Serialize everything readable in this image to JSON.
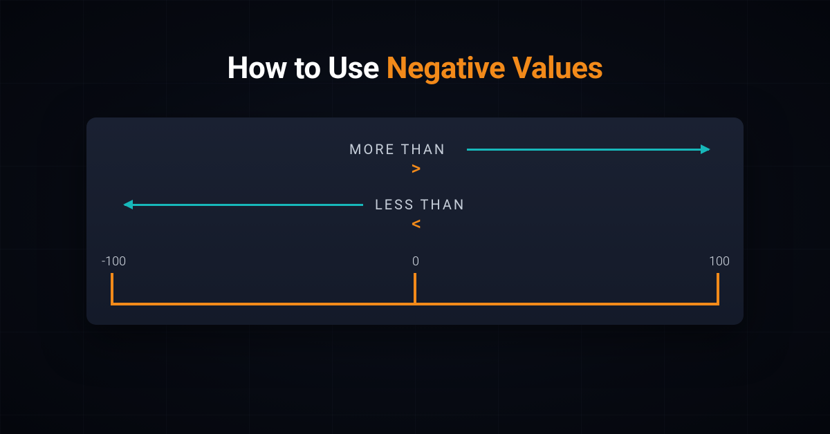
{
  "title": {
    "prefix": "How to Use ",
    "accent": "Negative Values"
  },
  "panel": {
    "more_label": "MORE THAN",
    "less_label": "LESS THAN",
    "chevron_gt": ">",
    "chevron_lt": "<",
    "ticks": {
      "neg": "-100",
      "zero": "0",
      "pos": "100"
    }
  },
  "colors": {
    "accent_orange": "#f28a1a",
    "arrow_teal": "#17b8ba",
    "panel_bg": "#1a2132",
    "text_light": "#d7dde6"
  }
}
